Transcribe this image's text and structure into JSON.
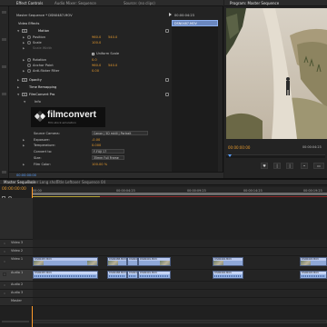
{
  "tabs_left": [
    "Effect Controls",
    "Audio Mixer: Sequence",
    "Source: (no clips)"
  ],
  "tabs_right": [
    "Program: Master Sequence"
  ],
  "effect_controls": {
    "header_left": "Master Sequence * DSN0487.MOV",
    "clip_name": "DSN0487.MOV",
    "panel_timecode": "00:00:04:23",
    "video_effects": "Video Effects",
    "motion": "Motion",
    "position_label": "Position",
    "position_x": "960.0",
    "position_y": "540.0",
    "scale_label": "Scale",
    "scale_value": "100.0",
    "scale_width_label": "Scale Width",
    "uniform_scale": "Uniform Scale",
    "rotation_label": "Rotation",
    "rotation_value": "0.0",
    "anchor_label": "Anchor Point",
    "anchor_x": "960.0",
    "anchor_y": "540.0",
    "antiflicker_label": "Anti-flicker Filter",
    "antiflicker_value": "0.00",
    "opacity": "Opacity",
    "time_remapping": "Time Remapping",
    "filmconvert": "FilmConvert Pro",
    "info_label": "Info",
    "logo_text": "filmconvert",
    "logo_sub": "film stock emulation",
    "source_camera_label": "Source Camera:",
    "source_camera_value": "Canon | 5D mkIII | Portrait",
    "exposure_label": "Exposure:",
    "exposure_value": "-0.00",
    "temperature_label": "Temperature:",
    "temperature_value": "0.000",
    "convert_to_label": "Convert to:",
    "convert_to_value": "F-FUJI 17",
    "size_label": "Size:",
    "size_value": "35mm Full Frame",
    "film_color_label": "Film Color:",
    "film_color_value": "100.00 %",
    "bottom_timecode": "00:00:00:00"
  },
  "program": {
    "timecode": "00:00:00:00",
    "zoom": "Fit",
    "right_tc": "00:00:04:23"
  },
  "timeline": {
    "tabs": [
      "Master Sequence",
      "Trailer Long shot",
      "Title Leftover",
      "Sequence 04"
    ],
    "timecode": "00:00:00:00",
    "ruler": [
      "00:00",
      "00:00:04:23",
      "00:00:09:23",
      "00:00:14:23",
      "00:00:19:23"
    ],
    "tracks": [
      {
        "name": "Video 3"
      },
      {
        "name": "Video 2"
      },
      {
        "name": "Video 1"
      },
      {
        "name": "Audio 1"
      },
      {
        "name": "Audio 2"
      },
      {
        "name": "Audio 3"
      },
      {
        "name": "Master"
      }
    ],
    "video_clips": [
      "DSN0487.MOV",
      "DSN0488.MOV",
      "DSN0490.MOV [V]",
      "DSN0491.MOV",
      "DSN0492.MOV",
      "DSN0493.MOV"
    ],
    "audio_clips": [
      "DSN0487.MOV",
      "DSN0488.MOV",
      "DSN0490.MOV [A]",
      "DSN0491.MOV",
      "DSN0492.MOV",
      "DSN0493.MOV"
    ]
  },
  "colors": {
    "panel_bg": "#232323",
    "accent_orange": "#e69a2e",
    "accent_blue": "#5aa0ff",
    "video_clip": "#8fa8d8",
    "audio_clip": "#96b4e6"
  }
}
